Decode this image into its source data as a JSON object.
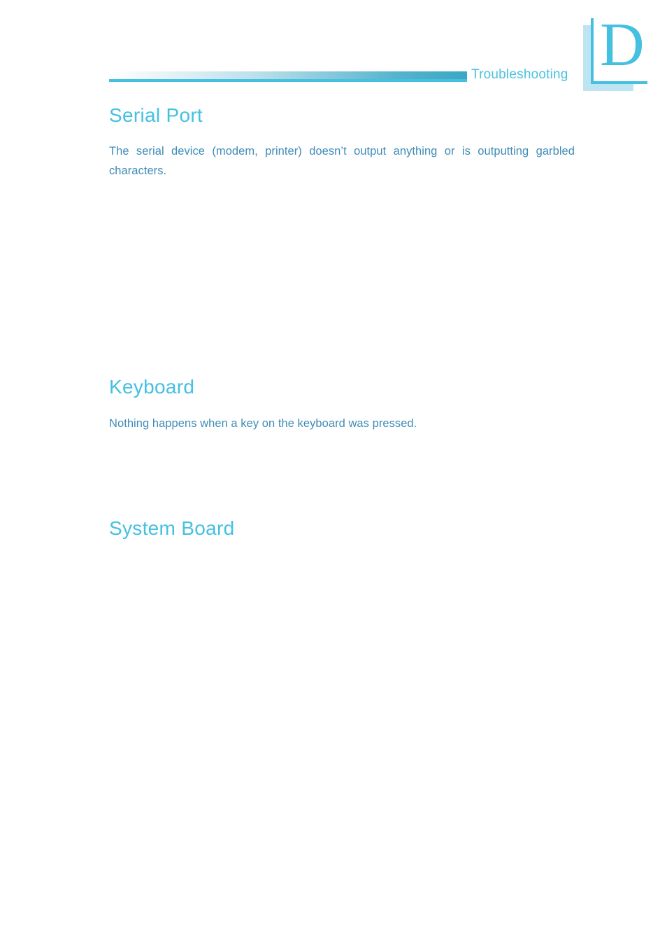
{
  "document": {
    "page_type": "appendix-page",
    "background_color": "#ffffff"
  },
  "header": {
    "chapter_letter": "D",
    "label": "Troubleshooting",
    "rule_color_start": "#ffffff",
    "rule_color_end": "#3aa8c4",
    "accent_color": "#45c0e0",
    "shadow_color": "#bde5f1"
  },
  "sections": [
    {
      "heading": "Serial Port",
      "body": "The serial device (modem, printer) doesn’t output anything or is outputting garbled characters."
    },
    {
      "heading": "Keyboard",
      "body": "Nothing happens when a key on the keyboard was pressed."
    },
    {
      "heading": "System Board",
      "body": ""
    }
  ],
  "colors": {
    "heading": "#45c0e0",
    "body_text": "#3e8cb8",
    "header_label": "#4bc2dd"
  }
}
